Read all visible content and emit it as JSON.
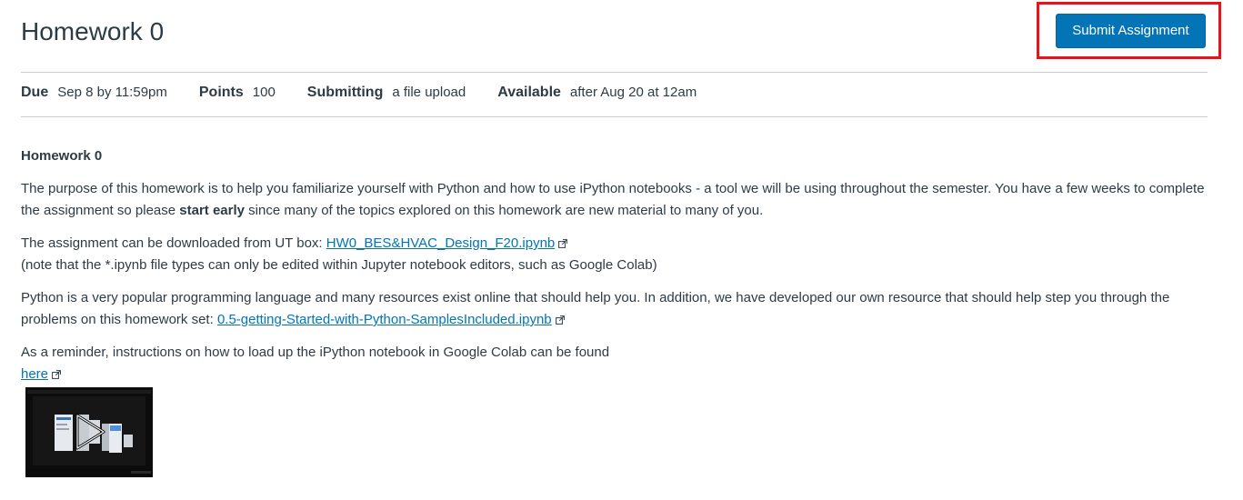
{
  "header": {
    "title": "Homework 0",
    "submit_label": "Submit Assignment"
  },
  "details": {
    "due_label": "Due",
    "due_value": "Sep 8 by 11:59pm",
    "points_label": "Points",
    "points_value": "100",
    "submitting_label": "Submitting",
    "submitting_value": "a file upload",
    "available_label": "Available",
    "available_value": "after Aug 20 at 12am"
  },
  "description": {
    "heading": "Homework 0",
    "p1_before": "The purpose of this homework is to help you familiarize yourself with Python and how to use iPython notebooks - a tool we will be using throughout the semester. You have a few weeks to complete the assignment so please ",
    "p1_bold": "start early",
    "p1_after": " since many of the topics explored on this homework are new material to many of you.",
    "p2_before": "The assignment can be downloaded from UT box: ",
    "p2_link": "HW0_BES&HVAC_Design_F20.ipynb",
    "p2_note": "(note that the *.ipynb file types can only be edited within Jupyter notebook editors, such as Google Colab)",
    "p3_before": "Python is a very popular programming language and many resources exist online that should help you. In addition, we have developed our own resource that should help step you through the problems on this homework set: ",
    "p3_link": "0.5-getting-Started-with-Python-SamplesIncluded.ipynb",
    "p4_text": "As a reminder, instructions on how to load up the iPython notebook in Google Colab can be found",
    "p4_link": "here"
  },
  "colors": {
    "accent": "#0374b5",
    "highlight": "#e8141a",
    "text": "#2d3b45",
    "divider": "#c7cdd1"
  },
  "icons": {
    "external_link": "external-link-icon",
    "play": "play-icon"
  }
}
